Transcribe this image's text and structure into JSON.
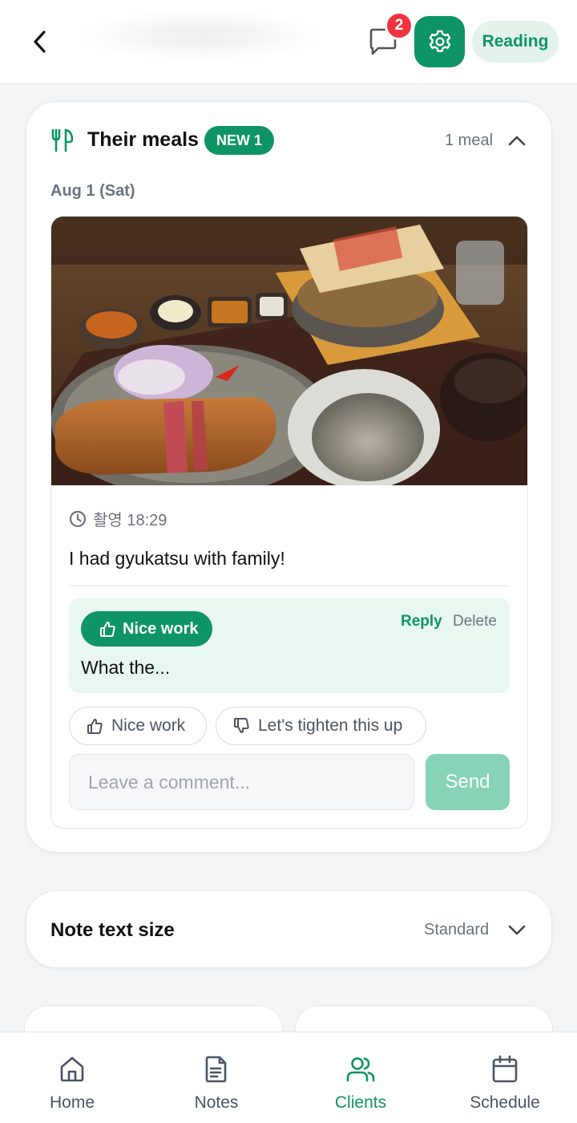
{
  "header": {
    "notification_count": "2",
    "reading_label": "Reading",
    "accent_color": "#0f9466"
  },
  "meals": {
    "title": "Their meals",
    "new_badge": "NEW 1",
    "meal_count": "1 meal",
    "date": "Aug 1 (Sat)",
    "entry": {
      "photo_icon": "meal-photo",
      "time": "촬영 18:29",
      "text": "I had gyukatsu with family!",
      "feedback": {
        "chip_label": "Nice work",
        "reply_label": "Reply",
        "delete_label": "Delete",
        "comment": "What the..."
      },
      "quick_replies": {
        "nice": "Nice work",
        "tighten": "Let's tighten this up"
      },
      "comment_placeholder": "Leave a comment...",
      "send_label": "Send"
    }
  },
  "note_size": {
    "title": "Note text size",
    "value": "Standard"
  },
  "bottom_nav": {
    "items": [
      {
        "label": "Home",
        "icon": "home-icon"
      },
      {
        "label": "Notes",
        "icon": "document-icon"
      },
      {
        "label": "Clients",
        "icon": "users-icon"
      },
      {
        "label": "Schedule",
        "icon": "calendar-icon"
      }
    ],
    "active": "Clients"
  }
}
